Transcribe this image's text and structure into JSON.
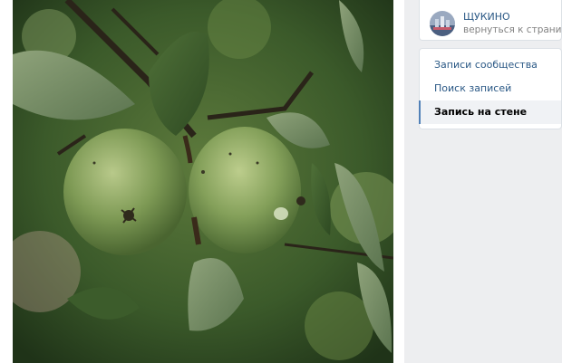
{
  "community": {
    "name": "ЩУКИНО",
    "back_link": "вернуться к странице"
  },
  "menu": {
    "items": [
      {
        "label": "Записи сообщества",
        "active": false
      },
      {
        "label": "Поиск записей",
        "active": false
      },
      {
        "label": "Запись на стене",
        "active": true
      }
    ]
  },
  "colors": {
    "link": "#2a5885",
    "active_marker": "#5181b8",
    "page_bg": "#edeef0"
  },
  "photo": {
    "icon": "apple-tree-photo"
  }
}
